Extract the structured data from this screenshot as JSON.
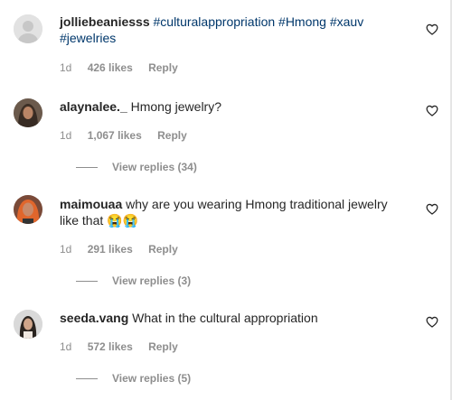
{
  "comments": [
    {
      "username": "jolliebeaniesss",
      "hashtags_line1": "#culturalappropriation #Hmong #xauv",
      "hashtags_line2": "#jewelries",
      "time": "1d",
      "likes": "426 likes",
      "reply": "Reply",
      "avatar_icon": "default-avatar-icon"
    },
    {
      "username": "alaynalee._",
      "text": "Hmong jewelry?",
      "time": "1d",
      "likes": "1,067 likes",
      "reply": "Reply",
      "view_replies": "View replies (34)",
      "avatar_icon": "profile-photo"
    },
    {
      "username": "maimouaa",
      "text_line1": "why are you wearing Hmong traditional jewelry",
      "text_line2": "like that",
      "emojis": "😭😭",
      "time": "1d",
      "likes": "291 likes",
      "reply": "Reply",
      "view_replies": "View replies (3)",
      "avatar_icon": "profile-photo"
    },
    {
      "username": "seeda.vang",
      "text": "What in the cultural appropriation",
      "time": "1d",
      "likes": "572 likes",
      "reply": "Reply",
      "view_replies": "View replies (5)",
      "avatar_icon": "profile-photo"
    }
  ],
  "icons": {
    "like": "heart-outline-icon"
  },
  "colors": {
    "hashtag": "#00376b",
    "meta": "#8e8e8e",
    "text": "#262626"
  }
}
